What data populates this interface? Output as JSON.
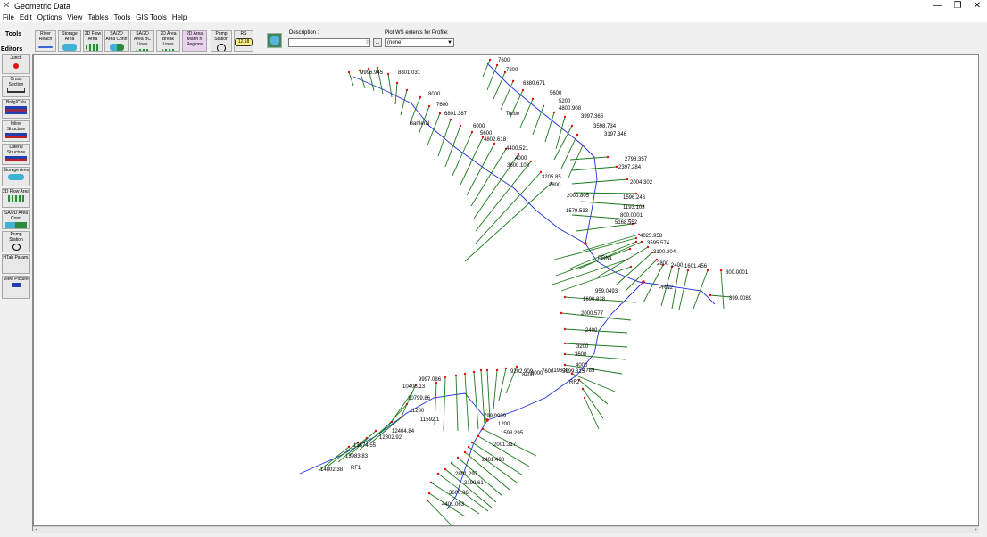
{
  "window": {
    "title": "Geometric Data",
    "min": "—",
    "max": "❐",
    "close": "✕"
  },
  "menu": [
    "File",
    "Edit",
    "Options",
    "View",
    "Tables",
    "Tools",
    "GIS Tools",
    "Help"
  ],
  "toolbar": {
    "tools_label": "Tools",
    "editors_label": "Editors",
    "buttons": [
      "River Reach",
      "Storage Area",
      "2D Flow Area",
      "SA/2D Area Conn",
      "SA/2D Area BC Lines",
      "2D Area Break Lines",
      "2D Area Mann n Regions",
      "Pump Station",
      "RS"
    ],
    "rs_value": "12.58",
    "description_label": "Description :",
    "description_value": "",
    "profile_label": "Plot WS extents for Profile:",
    "profile_value": "(none)",
    "dots_label": "..."
  },
  "sidebar": [
    "Junct.",
    "Cross Section",
    "Brdg/Culv",
    "Inline Structure",
    "Lateral Structure",
    "Storage Area",
    "2D Flow Area",
    "SA/2D Area Conn",
    "Pump Station",
    "HTab Param.",
    "View Picture"
  ],
  "colors": {
    "river": "#1f2fe0",
    "xs": "#1a7a1a",
    "node": "#e01010"
  },
  "labels": [
    {
      "t": "9996.945"
    },
    {
      "t": "8801.031"
    },
    {
      "t": "8000"
    },
    {
      "t": "7600"
    },
    {
      "t": "6801.387"
    },
    {
      "t": "Bartleral"
    },
    {
      "t": "6000"
    },
    {
      "t": "5600"
    },
    {
      "t": "4802.618"
    },
    {
      "t": "4400.521"
    },
    {
      "t": "4000"
    },
    {
      "t": "3600.108"
    },
    {
      "t": "3205.85"
    },
    {
      "t": "2800"
    },
    {
      "t": "2000.805"
    },
    {
      "t": "1579.533"
    },
    {
      "t": "7600"
    },
    {
      "t": "7200"
    },
    {
      "t": "6380.671"
    },
    {
      "t": "5600"
    },
    {
      "t": "5200"
    },
    {
      "t": "4800.908"
    },
    {
      "t": "Torbo"
    },
    {
      "t": "3997.365"
    },
    {
      "t": "3598.734"
    },
    {
      "t": "3197.346"
    },
    {
      "t": "2798.357"
    },
    {
      "t": "2397.284"
    },
    {
      "t": "2004.302"
    },
    {
      "t": "1596.246"
    },
    {
      "t": "1193.103"
    },
    {
      "t": "800.0001"
    },
    {
      "t": "5168.552"
    },
    {
      "t": "4025.958"
    },
    {
      "t": "3595.574"
    },
    {
      "t": "3100.304"
    },
    {
      "t": "2800"
    },
    {
      "t": "2400"
    },
    {
      "t": "1601.456"
    },
    {
      "t": "800.0001"
    },
    {
      "t": "399.0089"
    },
    {
      "t": "PRN1"
    },
    {
      "t": "PRN2"
    },
    {
      "t": "959.0493"
    },
    {
      "t": "1690.838"
    },
    {
      "t": "2000.577"
    },
    {
      "t": "2400"
    },
    {
      "t": "3200"
    },
    {
      "t": "3600"
    },
    {
      "t": "4000"
    },
    {
      "t": "9202.909"
    },
    {
      "t": "8400"
    },
    {
      "t": "8000"
    },
    {
      "t": "7600"
    },
    {
      "t": "7196.8"
    },
    {
      "t": "5999.315"
    },
    {
      "t": "4789"
    },
    {
      "t": "RF2"
    },
    {
      "t": "9997.086"
    },
    {
      "t": "10406.13"
    },
    {
      "t": "10799.86"
    },
    {
      "t": "11200"
    },
    {
      "t": "11592.1"
    },
    {
      "t": "12404.84"
    },
    {
      "t": "12802.92"
    },
    {
      "t": "13574.55"
    },
    {
      "t": "13983.83"
    },
    {
      "t": "RF1"
    },
    {
      "t": "14802.38"
    },
    {
      "t": "799.9999"
    },
    {
      "t": "1200"
    },
    {
      "t": "1598.295"
    },
    {
      "t": "2001.317"
    },
    {
      "t": "2401.408"
    },
    {
      "t": "2801.297"
    },
    {
      "t": "3199.61"
    },
    {
      "t": "3600.06"
    },
    {
      "t": "4401.063"
    }
  ]
}
